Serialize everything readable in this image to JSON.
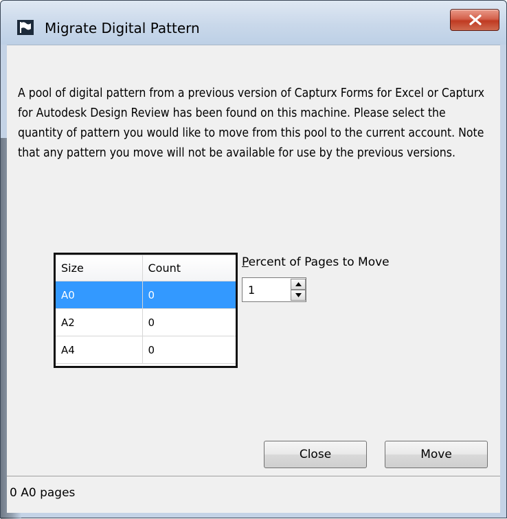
{
  "window": {
    "title": "Migrate Digital Pattern",
    "app_icon": "flag-icon",
    "close_icon": "close-icon"
  },
  "description": "A pool of digital pattern from a previous version of Capturx Forms for Excel or Capturx for Autodesk Design Review has been found on this machine. Please select the quantity of pattern you would like to move from this pool to the current account. Note that any pattern you move will not be available for use by the previous versions.",
  "grid": {
    "headers": [
      "Size",
      "Count"
    ],
    "rows": [
      {
        "size": "A0",
        "count": "0"
      },
      {
        "size": "A2",
        "count": "0"
      },
      {
        "size": "A4",
        "count": "0"
      }
    ],
    "selected_row": 0
  },
  "percent": {
    "label_mnemonic": "P",
    "label_rest": "ercent of Pages to Move",
    "value": "1"
  },
  "buttons": {
    "close": "Close",
    "move": "Move"
  },
  "status": "0 A0 pages",
  "colors": {
    "selection": "#3399ff",
    "close_button": "#c9452d"
  }
}
